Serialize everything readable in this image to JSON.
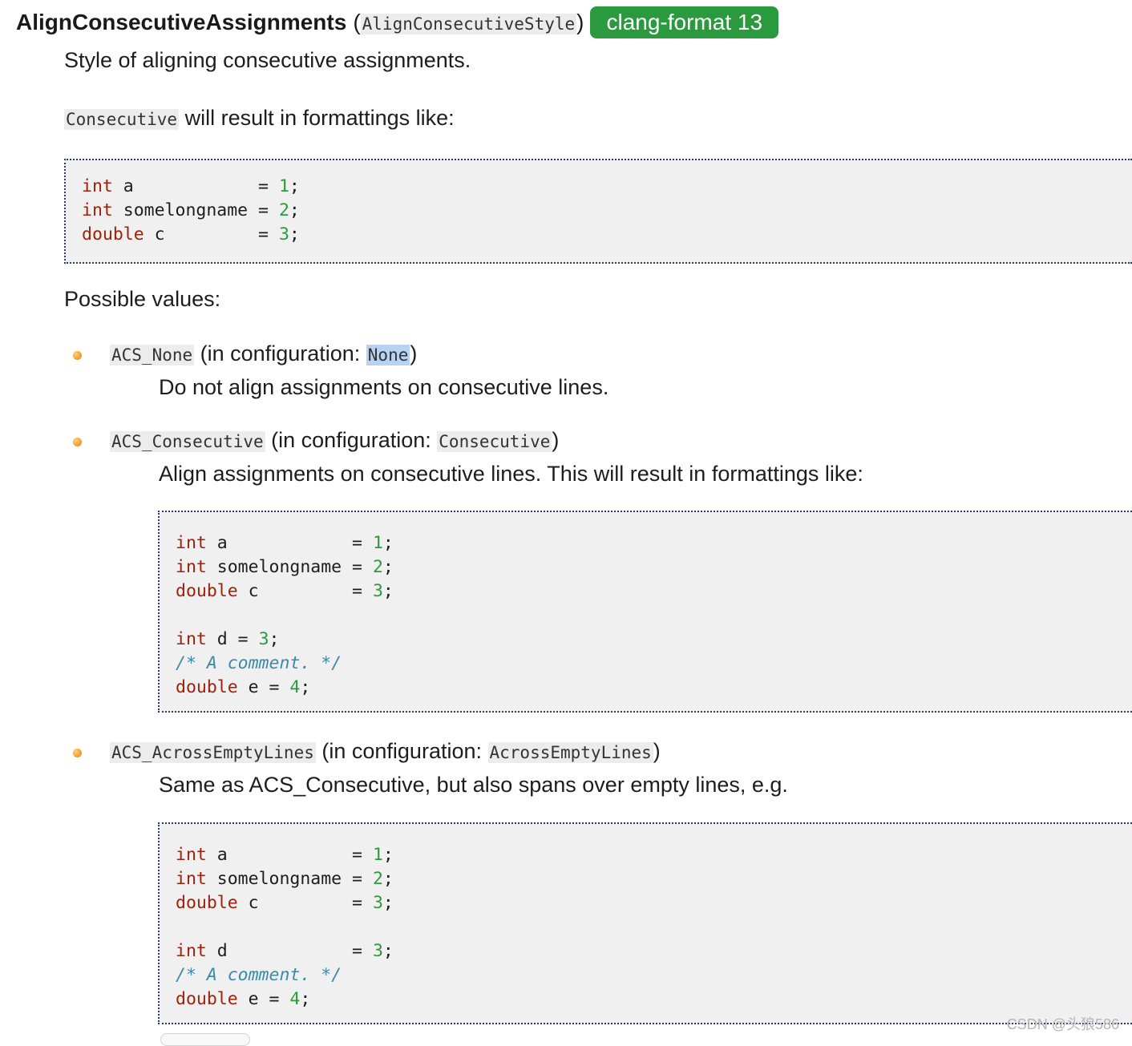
{
  "heading": {
    "name": "AlignConsecutiveAssignments",
    "open_paren": "(",
    "type": "AlignConsecutiveStyle",
    "close_paren": ")",
    "badge": "clang-format 13"
  },
  "intro": "Style of aligning consecutive assignments.",
  "example_intro": {
    "code": "Consecutive",
    "text": " will result in formattings like:"
  },
  "code_examples": {
    "consecutive_basic": [
      "int a            = 1;",
      "int somelongname = 2;",
      "double c         = 3;"
    ],
    "consecutive_option": [
      "int a            = 1;",
      "int somelongname = 2;",
      "double c         = 3;",
      "",
      "int d = 3;",
      "/* A comment. */",
      "double e = 4;"
    ],
    "across_empty_lines": [
      "int a            = 1;",
      "int somelongname = 2;",
      "double c         = 3;",
      "",
      "int d            = 3;",
      "/* A comment. */",
      "double e = 4;"
    ]
  },
  "possible_values_label": "Possible values:",
  "values": [
    {
      "enum": "ACS_None",
      "config_prefix": " (in configuration: ",
      "config": "None",
      "config_suffix": ")",
      "description": "Do not align assignments on consecutive lines."
    },
    {
      "enum": "ACS_Consecutive",
      "config_prefix": " (in configuration: ",
      "config": "Consecutive",
      "config_suffix": ")",
      "description": "Align assignments on consecutive lines. This will result in formattings like:"
    },
    {
      "enum": "ACS_AcrossEmptyLines",
      "config_prefix": " (in configuration: ",
      "config": "AcrossEmptyLines",
      "config_suffix": ")",
      "description": "Same as ACS_Consecutive, but also spans over empty lines, e.g."
    }
  ],
  "watermark": "CSDN @头狼586",
  "colors": {
    "badge": "#2b9a3e",
    "keyword": "#a0200a",
    "number": "#2b9a3e",
    "comment": "#3a8aa8",
    "selection": "#b7d2f3"
  }
}
